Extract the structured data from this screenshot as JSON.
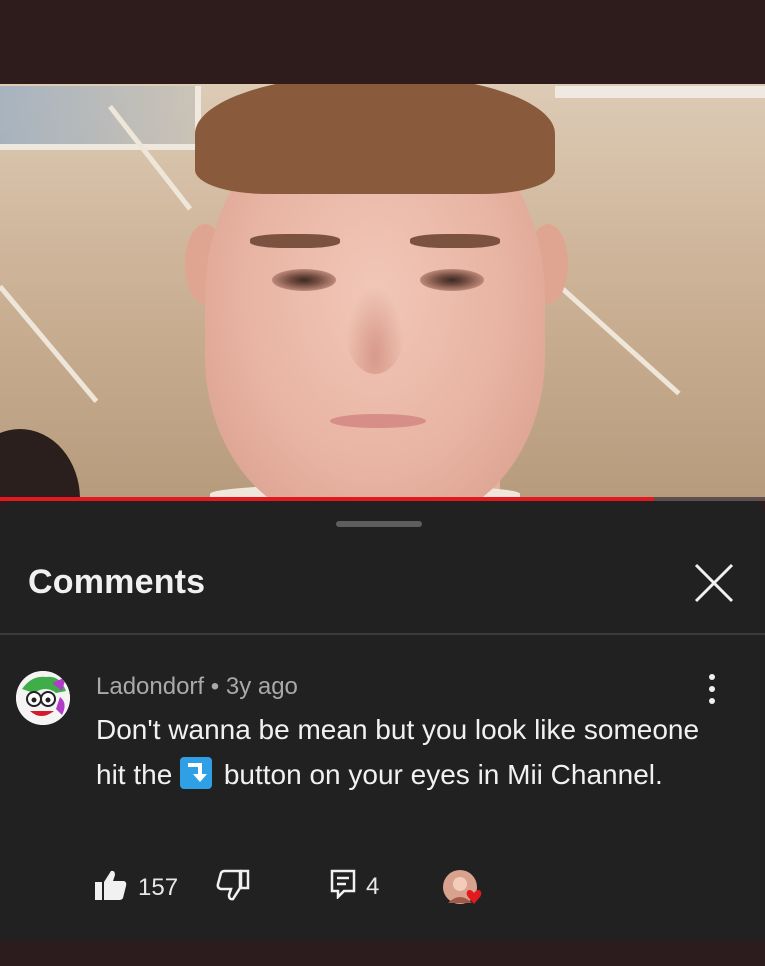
{
  "video": {
    "progress": 0.855,
    "accent_color": "#e21a1f"
  },
  "comments_sheet": {
    "title": "Comments",
    "close_icon": "close-icon"
  },
  "comment": {
    "author": "Ladondorf",
    "separator": "•",
    "time": "3y ago",
    "text_before_icon": "Don't wanna be mean but you look like someone hit the ",
    "inline_icon": "blue-return-arrow-icon",
    "text_after_icon": " button on your eyes in Mii Channel.",
    "likes": "157",
    "replies": "4",
    "like_icon": "thumbs-up-icon",
    "dislike_icon": "thumbs-down-icon",
    "reply_icon": "reply-icon",
    "more_icon": "more-vertical-icon"
  }
}
